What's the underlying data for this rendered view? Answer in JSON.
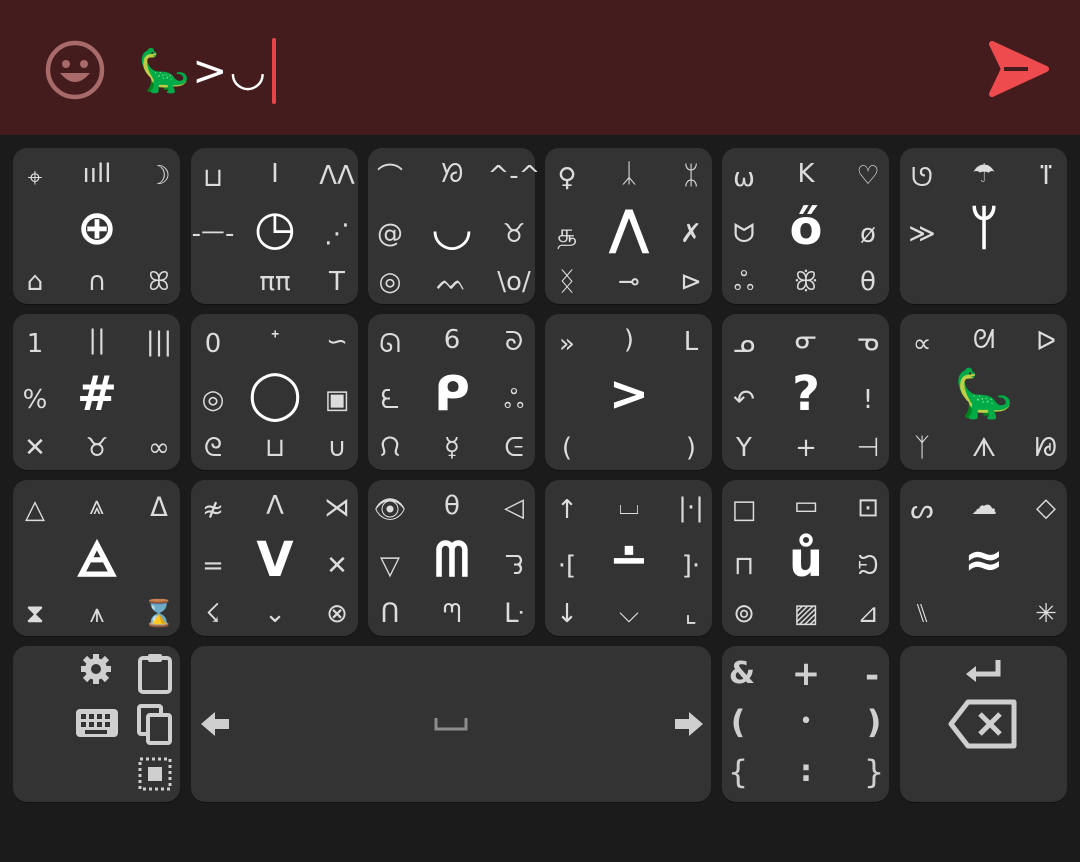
{
  "input": {
    "text": "🦕>◡"
  },
  "keys": [
    {
      "name": "key-group-1",
      "corners": [
        "⌖",
        "ııll",
        "☽"
      ],
      "middle_left": "",
      "center": "⊕",
      "middle_right": "",
      "bottom": [
        "⌂",
        "∩",
        "ꕤ"
      ]
    },
    {
      "name": "key-group-2",
      "corners": [
        "⊔",
        "I",
        "ɅΛ"
      ],
      "middle_left": "-ᅳ-",
      "center": "◷",
      "middle_right": "⋰",
      "bottom": [
        "",
        "ππ",
        "T"
      ]
    },
    {
      "name": "key-group-3",
      "corners": [
        "⌒",
        "ᘞ",
        "^-^"
      ],
      "middle_left": "@",
      "center": "◡",
      "middle_right": "♉",
      "bottom": [
        "◎",
        "ᨓ",
        "\\o/"
      ]
    },
    {
      "name": "key-group-4",
      "corners": [
        "♀",
        "ᛣ",
        "ᛯ"
      ],
      "middle_left": "௲",
      "center": "⋀",
      "middle_right": "✗",
      "bottom": [
        "ᛝ",
        "⊸",
        "⊳"
      ]
    },
    {
      "name": "key-group-5",
      "corners": [
        "ω",
        "K",
        "♡"
      ],
      "middle_left": "ᗢ",
      "center": "ő",
      "middle_right": "ø",
      "bottom": [
        "ஃ",
        "ꕥ",
        "θ"
      ]
    },
    {
      "name": "key-group-6",
      "corners": [
        "ᘎ",
        "☂",
        "ⴶ"
      ],
      "middle_left": "≫",
      "center": "ᛘ",
      "middle_right": "",
      "bottom": [
        "",
        "",
        ""
      ]
    },
    {
      "name": "key-group-7",
      "corners": [
        "1",
        "||",
        "|||"
      ],
      "middle_left": "%",
      "center": "#",
      "middle_right": "",
      "bottom": [
        "✕",
        "♉",
        "∞"
      ]
    },
    {
      "name": "key-group-8",
      "corners": [
        "0",
        "ᐩ",
        "∽"
      ],
      "middle_left": "◎",
      "center": "◯",
      "middle_right": "▣",
      "bottom": [
        "ᘓ",
        "⊔",
        "∪"
      ]
    },
    {
      "name": "key-group-9",
      "corners": [
        "ᘏ",
        "6",
        "ᘐ"
      ],
      "middle_left": "ᘍ",
      "center": "ᑭ",
      "middle_right": "ஃ",
      "bottom": [
        "ᙁ",
        "☿",
        "ᕮ"
      ]
    },
    {
      "name": "key-group-10",
      "corners": [
        "»",
        ")",
        "L"
      ],
      "middle_left": "",
      "center": ">",
      "middle_right": "",
      "bottom": [
        "(",
        "",
        ")"
      ]
    },
    {
      "name": "key-group-11",
      "corners": [
        "ᓄ",
        "ᓂ",
        "ᓀ"
      ],
      "middle_left": "↶",
      "center": "?",
      "middle_right": "!",
      "bottom": [
        "Y",
        "+",
        "⊣"
      ]
    },
    {
      "name": "key-group-12",
      "corners": [
        "∝",
        "ᘛ",
        "ᐅ"
      ],
      "middle_left": "",
      "center": "🦕",
      "middle_right": "",
      "bottom": [
        "ᛉ",
        "ᗑ",
        "ᘘ"
      ]
    },
    {
      "name": "key-group-13",
      "corners": [
        "△",
        "⩓",
        "ᐃ"
      ],
      "middle_left": "",
      "center": "🜁",
      "middle_right": "",
      "bottom": [
        "⧗",
        "⩚",
        "⌛"
      ]
    },
    {
      "name": "key-group-14",
      "corners": [
        "≉",
        "Λ",
        "⋊"
      ],
      "middle_left": "=",
      "center": "V",
      "middle_right": "✕",
      "bottom": [
        "☇",
        "⌄",
        "⊗"
      ]
    },
    {
      "name": "key-group-15",
      "corners": [
        "👁",
        "θ",
        "◁"
      ],
      "middle_left": "▽",
      "center": "ᗰ",
      "middle_right": "ᘊ",
      "bottom": [
        "ᑎ",
        "ᘉ",
        "ᒷ"
      ]
    },
    {
      "name": "key-group-16",
      "corners": [
        "↑",
        "⌴",
        "|·|"
      ],
      "middle_left": "·[",
      "center": "∸",
      "middle_right": "]·",
      "bottom": [
        "↓",
        "⌵",
        "⌞"
      ]
    },
    {
      "name": "key-group-17",
      "corners": [
        "□",
        "▭",
        "⊡"
      ],
      "middle_left": "⊓",
      "center": "ů",
      "middle_right": "ᙊ",
      "bottom": [
        "⊚",
        "▨",
        "⊿"
      ]
    },
    {
      "name": "key-group-18",
      "corners": [
        "ᔕ",
        "☁",
        "◇"
      ],
      "middle_left": "",
      "center": "≈",
      "middle_right": "",
      "bottom": [
        "⑊",
        "",
        "✳"
      ]
    }
  ],
  "operators": {
    "row1": [
      "&",
      "+",
      "-"
    ],
    "row2": [
      "(",
      "•",
      ")"
    ],
    "row3": [
      "{",
      ":",
      "}"
    ]
  },
  "icons": {
    "emoji": "smiley-face-icon",
    "send": "send-arrow-icon",
    "settings": "gear-icon",
    "keyboard": "keyboard-icon",
    "paste": "clipboard-icon",
    "copy": "copy-icon",
    "select_all": "select-all-icon",
    "left": "arrow-left-icon",
    "right": "arrow-right-icon",
    "space": "space-bar-icon",
    "enter": "enter-icon",
    "backspace": "backspace-icon"
  },
  "colors": {
    "topbar": "#441c1e",
    "accent": "#ee4b4f",
    "key": "#333333",
    "background": "#1b1b1b",
    "emoji": "#a96a6a"
  }
}
